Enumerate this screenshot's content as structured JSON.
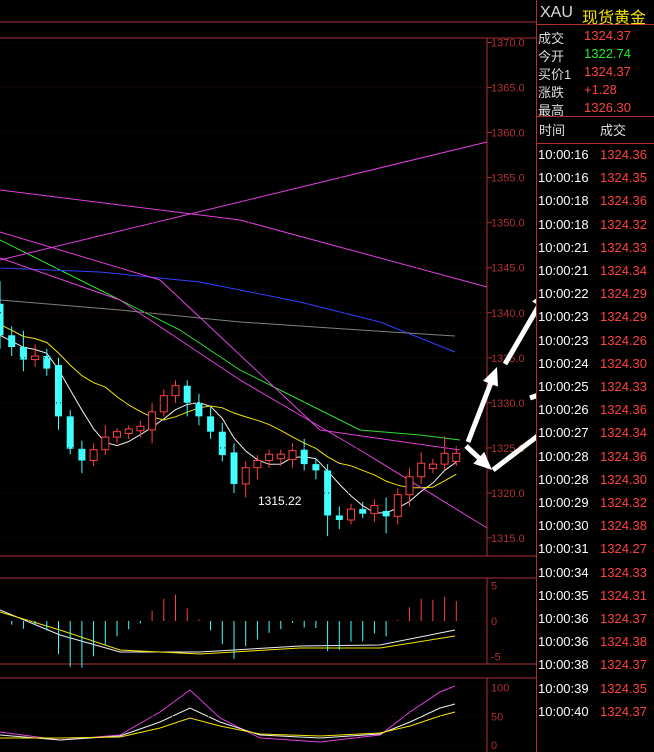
{
  "header": {
    "symbol": "XAU",
    "name": "现货黄金"
  },
  "quote": [
    {
      "label": "成交",
      "value": "1324.37",
      "color": "#ff4040"
    },
    {
      "label": "今开",
      "value": "1322.74",
      "color": "#22ee22"
    },
    {
      "label": "买价1",
      "value": "1324.37",
      "color": "#ff4040"
    },
    {
      "label": "涨跌",
      "value": "+1.28",
      "color": "#ff4040"
    },
    {
      "label": "最高",
      "value": "1326.30",
      "color": "#ff4040"
    }
  ],
  "ticks_header": {
    "time": "时间",
    "price": "成交"
  },
  "ticks": [
    {
      "time": "10:00:16",
      "price": "1324.36"
    },
    {
      "time": "10:00:16",
      "price": "1324.35"
    },
    {
      "time": "10:00:18",
      "price": "1324.36"
    },
    {
      "time": "10:00:18",
      "price": "1324.32"
    },
    {
      "time": "10:00:21",
      "price": "1324.33"
    },
    {
      "time": "10:00:21",
      "price": "1324.34"
    },
    {
      "time": "10:00:22",
      "price": "1324.29"
    },
    {
      "time": "10:00:23",
      "price": "1324.29"
    },
    {
      "time": "10:00:23",
      "price": "1324.26"
    },
    {
      "time": "10:00:24",
      "price": "1324.30"
    },
    {
      "time": "10:00:25",
      "price": "1324.33"
    },
    {
      "time": "10:00:26",
      "price": "1324.36"
    },
    {
      "time": "10:00:27",
      "price": "1324.34"
    },
    {
      "time": "10:00:28",
      "price": "1324.36"
    },
    {
      "time": "10:00:28",
      "price": "1324.30"
    },
    {
      "time": "10:00:29",
      "price": "1324.32"
    },
    {
      "time": "10:00:30",
      "price": "1324.38"
    },
    {
      "time": "10:00:31",
      "price": "1324.27"
    },
    {
      "time": "10:00:34",
      "price": "1324.33"
    },
    {
      "time": "10:00:35",
      "price": "1324.31"
    },
    {
      "time": "10:00:36",
      "price": "1324.37"
    },
    {
      "time": "10:00:36",
      "price": "1324.38"
    },
    {
      "time": "10:00:38",
      "price": "1324.37"
    },
    {
      "time": "10:00:39",
      "price": "1324.35"
    },
    {
      "time": "10:00:40",
      "price": "1324.37"
    }
  ],
  "colors": {
    "up": "#ff4040",
    "down": "#40ffff",
    "border": "#b03030",
    "ticks_price": "#ff4040",
    "ticks_time": "#ffffff"
  },
  "chart_data": {
    "type": "candlestick",
    "ylim": [
      1313,
      1370.5
    ],
    "y_ticks": [
      "1370.0",
      "1365.0",
      "1360.0",
      "1355.0",
      "1350.0",
      "1345.0",
      "1340.0",
      "1335.0",
      "1330.0",
      "1325.0",
      "1320.0",
      "1315.0"
    ],
    "low_annotation": "1315.22",
    "candles": [
      {
        "o": 1341.0,
        "h": 1343.5,
        "l": 1336.0,
        "c": 1337.5
      },
      {
        "o": 1337.5,
        "h": 1338.5,
        "l": 1335.2,
        "c": 1336.2
      },
      {
        "o": 1336.2,
        "h": 1338.0,
        "l": 1333.5,
        "c": 1334.8
      },
      {
        "o": 1334.8,
        "h": 1336.5,
        "l": 1334.0,
        "c": 1335.2
      },
      {
        "o": 1335.2,
        "h": 1336.0,
        "l": 1333.0,
        "c": 1333.8
      },
      {
        "o": 1334.2,
        "h": 1335.0,
        "l": 1327.0,
        "c": 1328.5
      },
      {
        "o": 1328.5,
        "h": 1329.2,
        "l": 1324.3,
        "c": 1324.9
      },
      {
        "o": 1324.9,
        "h": 1325.8,
        "l": 1322.2,
        "c": 1323.6
      },
      {
        "o": 1323.6,
        "h": 1325.5,
        "l": 1323.0,
        "c": 1324.8
      },
      {
        "o": 1324.8,
        "h": 1327.5,
        "l": 1324.2,
        "c": 1326.2
      },
      {
        "o": 1326.2,
        "h": 1327.2,
        "l": 1325.5,
        "c": 1326.8
      },
      {
        "o": 1326.6,
        "h": 1327.5,
        "l": 1326.0,
        "c": 1327.1
      },
      {
        "o": 1326.9,
        "h": 1328.0,
        "l": 1326.2,
        "c": 1327.4
      },
      {
        "o": 1327.0,
        "h": 1330.0,
        "l": 1325.5,
        "c": 1329.0
      },
      {
        "o": 1329.0,
        "h": 1331.5,
        "l": 1328.5,
        "c": 1330.8
      },
      {
        "o": 1330.8,
        "h": 1332.5,
        "l": 1330.0,
        "c": 1331.9
      },
      {
        "o": 1331.9,
        "h": 1332.5,
        "l": 1328.5,
        "c": 1330.0
      },
      {
        "o": 1330.0,
        "h": 1331.0,
        "l": 1327.5,
        "c": 1328.5
      },
      {
        "o": 1328.5,
        "h": 1329.5,
        "l": 1326.0,
        "c": 1326.8
      },
      {
        "o": 1326.8,
        "h": 1327.8,
        "l": 1323.5,
        "c": 1324.2
      },
      {
        "o": 1324.5,
        "h": 1325.5,
        "l": 1320.0,
        "c": 1321.0
      },
      {
        "o": 1321.0,
        "h": 1323.5,
        "l": 1319.5,
        "c": 1322.8
      },
      {
        "o": 1322.8,
        "h": 1324.2,
        "l": 1321.5,
        "c": 1323.6
      },
      {
        "o": 1323.6,
        "h": 1324.8,
        "l": 1322.8,
        "c": 1324.3
      },
      {
        "o": 1323.8,
        "h": 1324.8,
        "l": 1323.0,
        "c": 1324.3
      },
      {
        "o": 1323.7,
        "h": 1325.5,
        "l": 1322.8,
        "c": 1324.7
      },
      {
        "o": 1324.8,
        "h": 1326.0,
        "l": 1322.5,
        "c": 1323.2
      },
      {
        "o": 1323.2,
        "h": 1323.8,
        "l": 1321.5,
        "c": 1322.5
      },
      {
        "o": 1322.5,
        "h": 1323.2,
        "l": 1315.2,
        "c": 1317.5
      },
      {
        "o": 1317.5,
        "h": 1318.5,
        "l": 1316.0,
        "c": 1317.0
      },
      {
        "o": 1317.0,
        "h": 1318.8,
        "l": 1316.5,
        "c": 1318.2
      },
      {
        "o": 1318.2,
        "h": 1319.0,
        "l": 1317.2,
        "c": 1317.7
      },
      {
        "o": 1317.7,
        "h": 1319.3,
        "l": 1316.8,
        "c": 1318.6
      },
      {
        "o": 1318.0,
        "h": 1319.5,
        "l": 1315.5,
        "c": 1317.4
      },
      {
        "o": 1317.4,
        "h": 1320.5,
        "l": 1316.5,
        "c": 1319.8
      },
      {
        "o": 1319.8,
        "h": 1322.8,
        "l": 1318.5,
        "c": 1321.8
      },
      {
        "o": 1321.8,
        "h": 1324.5,
        "l": 1321.0,
        "c": 1323.3
      },
      {
        "o": 1322.7,
        "h": 1323.8,
        "l": 1322.2,
        "c": 1323.2
      },
      {
        "o": 1323.2,
        "h": 1326.3,
        "l": 1322.5,
        "c": 1324.4
      },
      {
        "o": 1323.5,
        "h": 1325.2,
        "l": 1323.0,
        "c": 1324.4
      }
    ],
    "indicator1": {
      "y_ticks": [
        "5",
        "0",
        "-5"
      ],
      "ylim": [
        -5.5,
        5.5
      ]
    },
    "indicator2": {
      "y_ticks": [
        "100",
        "50",
        "0"
      ],
      "ylim": [
        -5,
        110
      ]
    }
  }
}
